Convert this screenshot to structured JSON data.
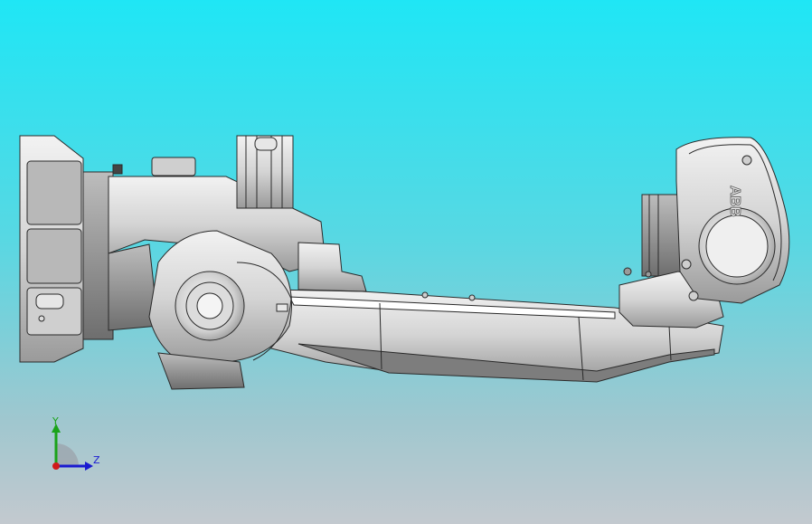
{
  "viewport": {
    "background_top": "#1fe6f5",
    "background_bottom": "#c3c9cf"
  },
  "model": {
    "brand_label": "ABB",
    "part_color": "#d9d9d9",
    "shadow_color": "#8a8a8a",
    "edge_color": "#2a2a2a"
  },
  "triad": {
    "y_label": "Y",
    "z_label": "Z",
    "y_color": "#1aa31a",
    "z_color": "#1a1ad0",
    "origin_color": "#d01a1a"
  }
}
